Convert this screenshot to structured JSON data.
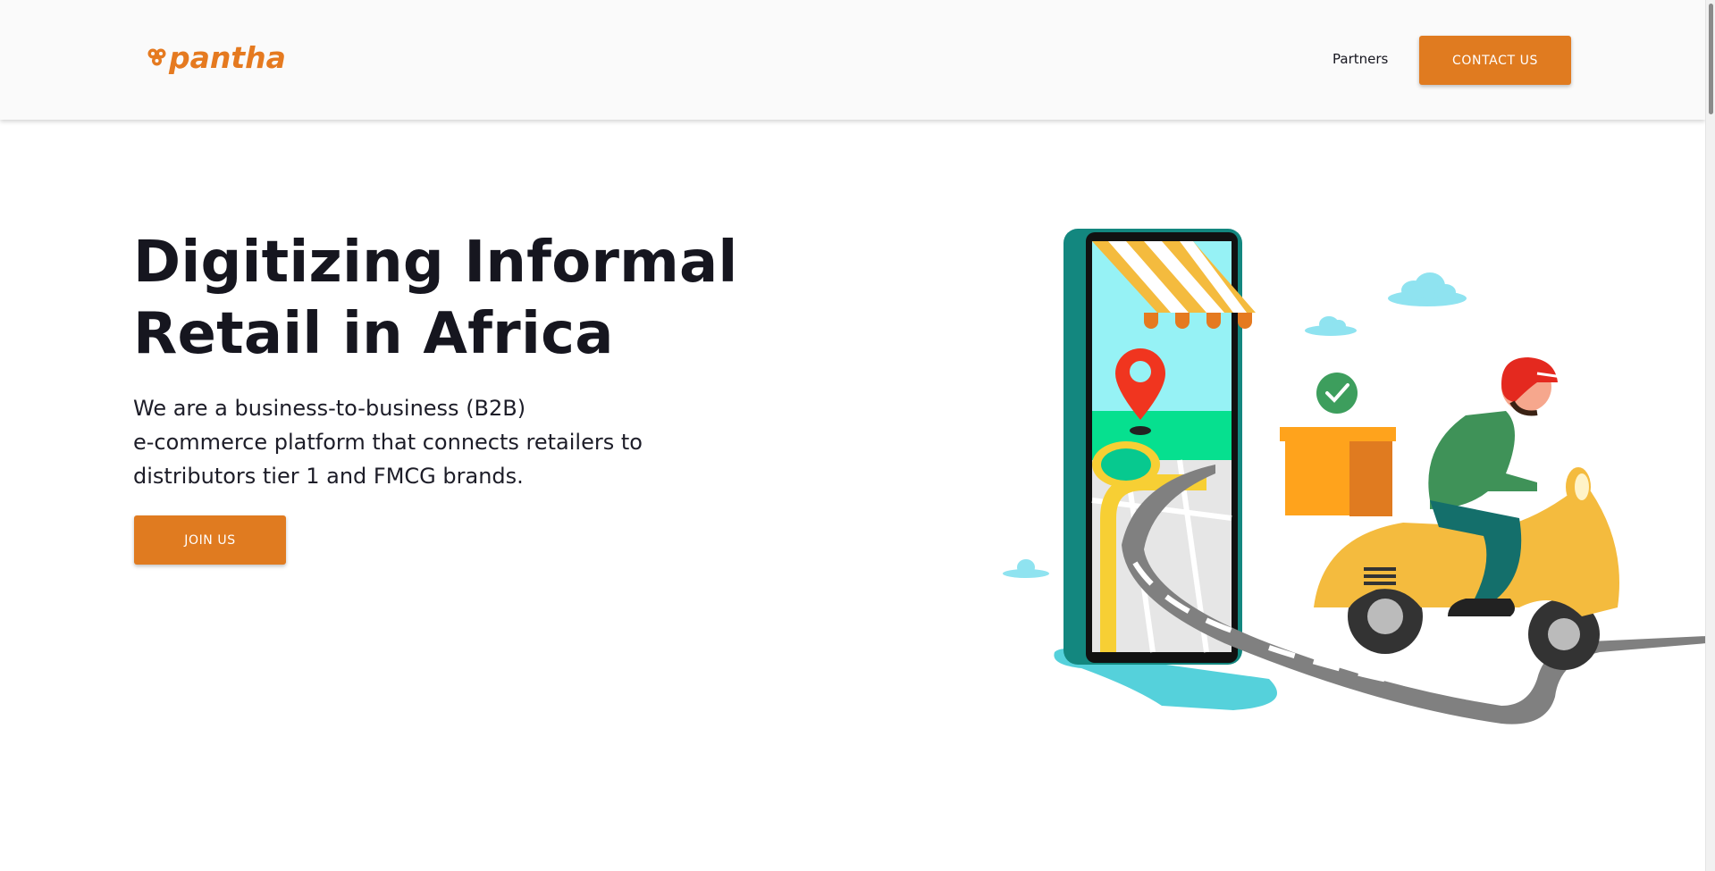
{
  "header": {
    "logo_text": "pantha",
    "nav_links": [
      "Partners"
    ],
    "contact_label": "CONTACT US"
  },
  "hero": {
    "title_line1": "Digitizing Informal",
    "title_line2": "Retail in Africa",
    "subtitle_line1": "We are a business-to-business (B2B)",
    "subtitle_line2": "e-commerce platform that connects retailers to",
    "subtitle_line3": "distributors tier 1 and FMCG brands.",
    "join_label": "JOIN US"
  },
  "colors": {
    "brand_orange": "#e07b20",
    "text_dark": "#16161f",
    "header_bg": "#fafafa",
    "phone_teal": "#13877f",
    "cloud_blue": "#8fe3f0",
    "road_gray": "#808080"
  },
  "icons": {
    "logo": "pantha-logo-icon",
    "illustration": "delivery-scooter-illustration"
  }
}
